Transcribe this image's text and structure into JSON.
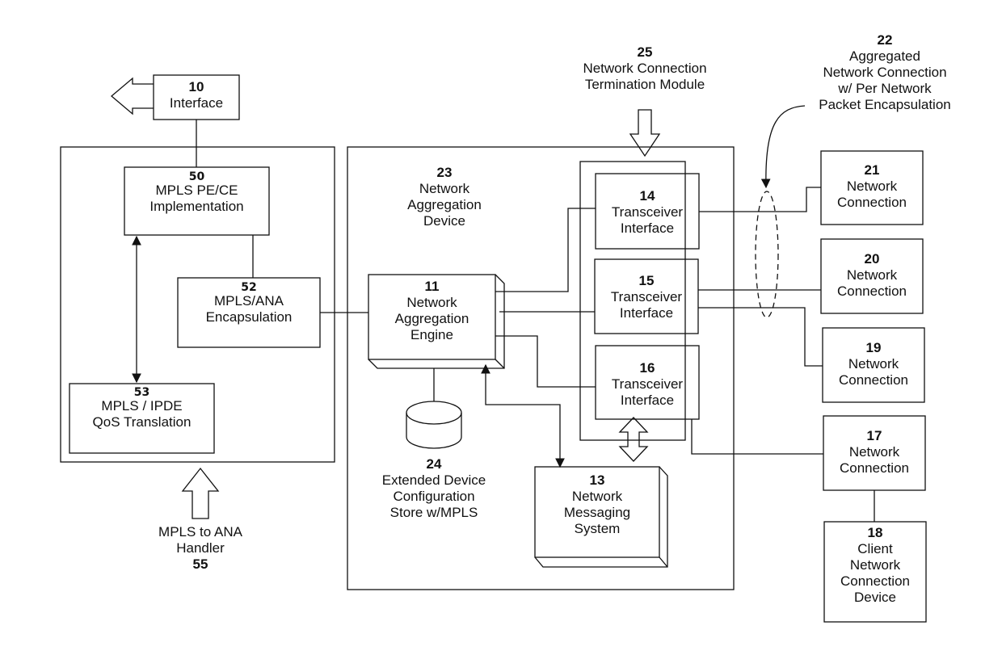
{
  "figure": {
    "type": "block-diagram",
    "colors": {
      "ink": "#111111",
      "paper": "#ffffff"
    }
  },
  "blocks": {
    "interface": {
      "num": "10",
      "lines": [
        "Interface"
      ]
    },
    "mpls_pe_ce": {
      "num": "50",
      "lines": [
        "MPLS PE/CE",
        "Implementation"
      ]
    },
    "mpls_ana_encap": {
      "num": "52",
      "lines": [
        "MPLS/ANA",
        "Encapsulation"
      ]
    },
    "mpls_ipde_qos": {
      "num": "53",
      "lines": [
        "MPLS / IPDE",
        "QoS Translation"
      ]
    },
    "handler": {
      "lines": [
        "MPLS to  ANA",
        "Handler"
      ],
      "num": "55"
    },
    "aggregation_device": {
      "num": "23",
      "lines": [
        "Network",
        "Aggregation",
        "Device"
      ]
    },
    "aggregation_engine": {
      "num": "11",
      "lines": [
        "Network",
        "Aggregation",
        "Engine"
      ]
    },
    "config_store": {
      "num": "24",
      "lines": [
        "Extended Device",
        "Configuration",
        "Store w/MPLS"
      ]
    },
    "messaging_system": {
      "num": "13",
      "lines": [
        "Network",
        "Messaging",
        "System"
      ]
    },
    "termination_module": {
      "num": "25",
      "lines": [
        "Network Connection",
        "Termination Module"
      ]
    },
    "transceiver_14": {
      "num": "14",
      "lines": [
        "Transceiver",
        "Interface"
      ]
    },
    "transceiver_15": {
      "num": "15",
      "lines": [
        "Transceiver",
        "Interface"
      ]
    },
    "transceiver_16": {
      "num": "16",
      "lines": [
        "Transceiver",
        "Interface"
      ]
    },
    "aggregated_connection": {
      "num": "22",
      "lines": [
        "Aggregated",
        "Network Connection",
        "w/ Per Network",
        "Packet Encapsulation"
      ]
    },
    "connection_21": {
      "num": "21",
      "lines": [
        "Network",
        "Connection"
      ]
    },
    "connection_20": {
      "num": "20",
      "lines": [
        "Network",
        "Connection"
      ]
    },
    "connection_19": {
      "num": "19",
      "lines": [
        "Network",
        "Connection"
      ]
    },
    "connection_17": {
      "num": "17",
      "lines": [
        "Network",
        "Connection"
      ]
    },
    "client_device": {
      "num": "18",
      "lines": [
        "Client",
        "Network",
        "Connection",
        "Device"
      ]
    }
  }
}
